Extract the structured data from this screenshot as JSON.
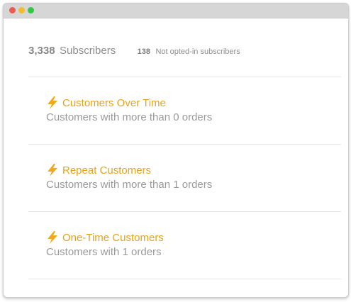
{
  "window": {
    "controls": [
      "close",
      "minimize",
      "maximize"
    ]
  },
  "summary": {
    "subscriber_count": "3,338",
    "subscriber_label": "Subscribers",
    "not_opted_count": "138",
    "not_opted_label": "Not opted-in subscribers"
  },
  "segments": [
    {
      "name": "Customers Over Time",
      "description": "Customers with more than 0 orders",
      "icon": "lightning-bolt-icon"
    },
    {
      "name": "Repeat Customers",
      "description": "Customers with more than 1 orders",
      "icon": "lightning-bolt-icon"
    },
    {
      "name": "One-Time Customers",
      "description": "Customers with 1 orders",
      "icon": "lightning-bolt-icon"
    }
  ],
  "colors": {
    "accent": "#e8a21a",
    "muted_text": "#9a9a9a",
    "divider": "#e3e3e3",
    "titlebar": "#d6d6d6"
  }
}
